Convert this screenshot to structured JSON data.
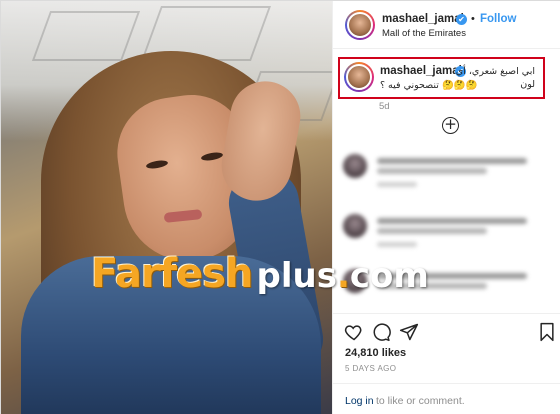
{
  "post": {
    "username": "mashael_jamal",
    "verified_glyph": "✔",
    "separator": "•",
    "follow_label": "Follow",
    "location": "Mall of the Emirates"
  },
  "caption": {
    "username": "mashael_jamal",
    "text_line1": "ابي اصبغ شعري، أي لون",
    "text_line2": "🤔🤔🤔 تنصحوني فيه ؟",
    "time": "5d"
  },
  "load_more_glyph": "+",
  "stats": {
    "likes": "24,810 likes",
    "time_ago": "5 DAYS AGO"
  },
  "footer": {
    "login_link": "Log in",
    "login_rest": "to like or comment."
  },
  "watermark": {
    "main": "Farfesh",
    "plus": "plus",
    "dot": ".",
    "com": "com"
  },
  "icons": {
    "heart": "heart-icon",
    "comment": "comment-icon",
    "share": "share-icon",
    "bookmark": "bookmark-icon"
  },
  "colors": {
    "accent_blue": "#3897f0",
    "highlight_red": "#d0021b",
    "watermark_orange": "#f5a623"
  }
}
